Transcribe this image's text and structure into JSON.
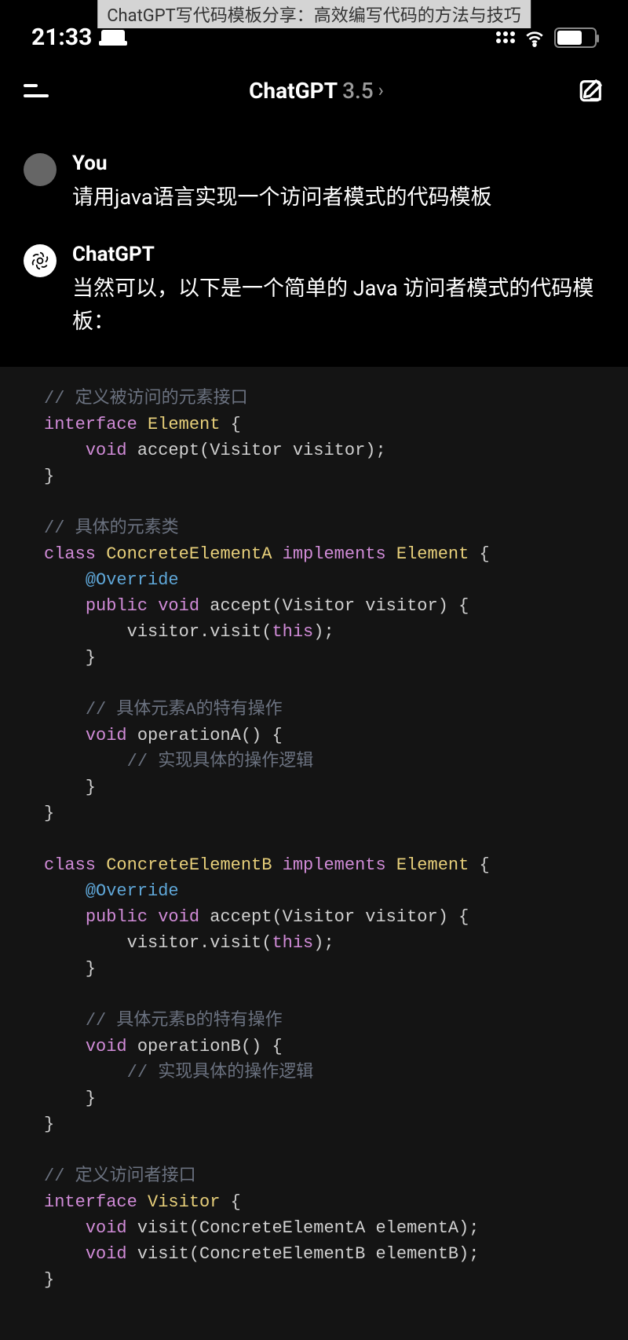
{
  "banner": "ChatGPT写代码模板分享：高效编写代码的方法与技巧",
  "status": {
    "time": "21:33",
    "battery": "66"
  },
  "header": {
    "app_name": "ChatGPT",
    "version": "3.5",
    "chevron": "›"
  },
  "messages": {
    "user": {
      "name": "You",
      "text": "请用java语言实现一个访问者模式的代码模板"
    },
    "bot": {
      "name": "ChatGPT",
      "text": "当然可以，以下是一个简单的 Java 访问者模式的代码模板："
    }
  },
  "code": {
    "tokens": [
      [
        "comment",
        "// 定义被访问的元素接口"
      ],
      [
        "nl",
        ""
      ],
      [
        "key",
        "interface"
      ],
      [
        "plain",
        " "
      ],
      [
        "type",
        "Element"
      ],
      [
        "punc",
        " {"
      ],
      [
        "nl",
        ""
      ],
      [
        "plain",
        "    "
      ],
      [
        "key",
        "void"
      ],
      [
        "plain",
        " accept(Visitor visitor);"
      ],
      [
        "nl",
        ""
      ],
      [
        "punc",
        "}"
      ],
      [
        "nl",
        ""
      ],
      [
        "nl",
        ""
      ],
      [
        "comment",
        "// 具体的元素类"
      ],
      [
        "nl",
        ""
      ],
      [
        "key",
        "class"
      ],
      [
        "plain",
        " "
      ],
      [
        "type",
        "ConcreteElementA"
      ],
      [
        "plain",
        " "
      ],
      [
        "key",
        "implements"
      ],
      [
        "plain",
        " "
      ],
      [
        "type",
        "Element"
      ],
      [
        "punc",
        " {"
      ],
      [
        "nl",
        ""
      ],
      [
        "plain",
        "    "
      ],
      [
        "anno",
        "@Override"
      ],
      [
        "nl",
        ""
      ],
      [
        "plain",
        "    "
      ],
      [
        "key",
        "public"
      ],
      [
        "plain",
        " "
      ],
      [
        "key",
        "void"
      ],
      [
        "plain",
        " accept(Visitor visitor) {"
      ],
      [
        "nl",
        ""
      ],
      [
        "plain",
        "        visitor.visit("
      ],
      [
        "this",
        "this"
      ],
      [
        "plain",
        ");"
      ],
      [
        "nl",
        ""
      ],
      [
        "plain",
        "    }"
      ],
      [
        "nl",
        ""
      ],
      [
        "nl",
        ""
      ],
      [
        "plain",
        "    "
      ],
      [
        "comment",
        "// 具体元素A的特有操作"
      ],
      [
        "nl",
        ""
      ],
      [
        "plain",
        "    "
      ],
      [
        "key",
        "void"
      ],
      [
        "plain",
        " operationA() {"
      ],
      [
        "nl",
        ""
      ],
      [
        "plain",
        "        "
      ],
      [
        "comment",
        "// 实现具体的操作逻辑"
      ],
      [
        "nl",
        ""
      ],
      [
        "plain",
        "    }"
      ],
      [
        "nl",
        ""
      ],
      [
        "punc",
        "}"
      ],
      [
        "nl",
        ""
      ],
      [
        "nl",
        ""
      ],
      [
        "key",
        "class"
      ],
      [
        "plain",
        " "
      ],
      [
        "type",
        "ConcreteElementB"
      ],
      [
        "plain",
        " "
      ],
      [
        "key",
        "implements"
      ],
      [
        "plain",
        " "
      ],
      [
        "type",
        "Element"
      ],
      [
        "punc",
        " {"
      ],
      [
        "nl",
        ""
      ],
      [
        "plain",
        "    "
      ],
      [
        "anno",
        "@Override"
      ],
      [
        "nl",
        ""
      ],
      [
        "plain",
        "    "
      ],
      [
        "key",
        "public"
      ],
      [
        "plain",
        " "
      ],
      [
        "key",
        "void"
      ],
      [
        "plain",
        " accept(Visitor visitor) {"
      ],
      [
        "nl",
        ""
      ],
      [
        "plain",
        "        visitor.visit("
      ],
      [
        "this",
        "this"
      ],
      [
        "plain",
        ");"
      ],
      [
        "nl",
        ""
      ],
      [
        "plain",
        "    }"
      ],
      [
        "nl",
        ""
      ],
      [
        "nl",
        ""
      ],
      [
        "plain",
        "    "
      ],
      [
        "comment",
        "// 具体元素B的特有操作"
      ],
      [
        "nl",
        ""
      ],
      [
        "plain",
        "    "
      ],
      [
        "key",
        "void"
      ],
      [
        "plain",
        " operationB() {"
      ],
      [
        "nl",
        ""
      ],
      [
        "plain",
        "        "
      ],
      [
        "comment",
        "// 实现具体的操作逻辑"
      ],
      [
        "nl",
        ""
      ],
      [
        "plain",
        "    }"
      ],
      [
        "nl",
        ""
      ],
      [
        "punc",
        "}"
      ],
      [
        "nl",
        ""
      ],
      [
        "nl",
        ""
      ],
      [
        "comment",
        "// 定义访问者接口"
      ],
      [
        "nl",
        ""
      ],
      [
        "key",
        "interface"
      ],
      [
        "plain",
        " "
      ],
      [
        "type",
        "Visitor"
      ],
      [
        "punc",
        " {"
      ],
      [
        "nl",
        ""
      ],
      [
        "plain",
        "    "
      ],
      [
        "key",
        "void"
      ],
      [
        "plain",
        " visit(ConcreteElementA elementA);"
      ],
      [
        "nl",
        ""
      ],
      [
        "plain",
        "    "
      ],
      [
        "key",
        "void"
      ],
      [
        "plain",
        " visit(ConcreteElementB elementB);"
      ],
      [
        "nl",
        ""
      ],
      [
        "punc",
        "}"
      ]
    ]
  }
}
